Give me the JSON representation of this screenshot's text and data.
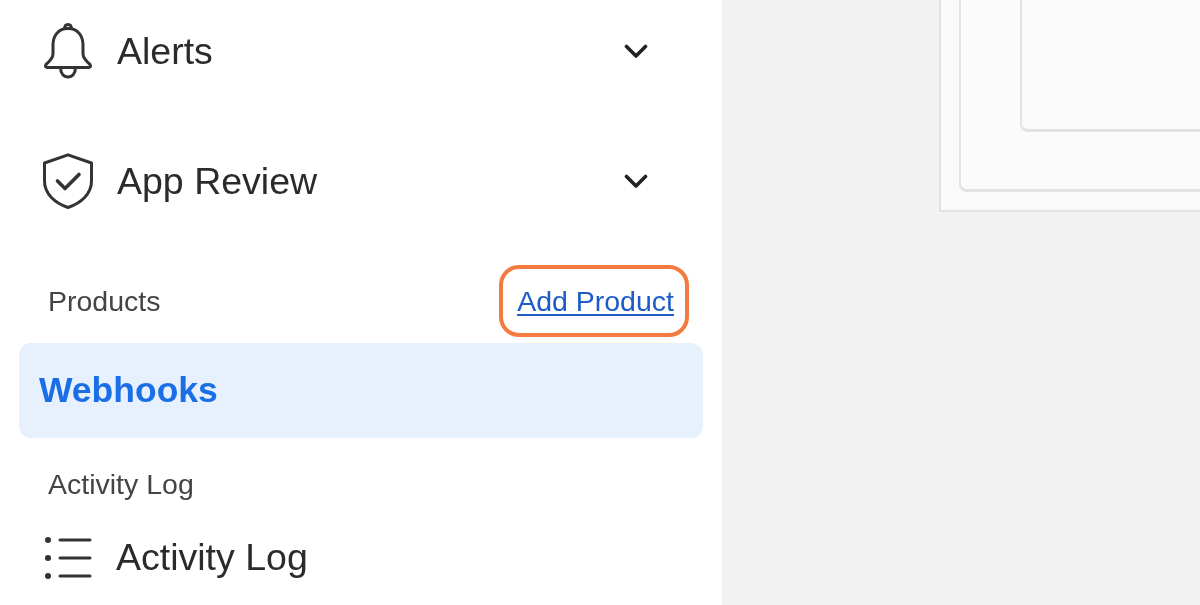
{
  "sidebar": {
    "nav": [
      {
        "label": "Alerts",
        "expanded": false
      },
      {
        "label": "App Review",
        "expanded": false
      }
    ],
    "sections": [
      {
        "title": "Products",
        "action": {
          "label": "Add Product",
          "highlighted": true
        },
        "items": [
          {
            "kind": "product",
            "label": "Webhooks",
            "selected": true
          }
        ]
      },
      {
        "title": "Activity Log",
        "items": [
          {
            "kind": "page",
            "label": "Activity Log",
            "selected": false
          }
        ]
      }
    ]
  }
}
